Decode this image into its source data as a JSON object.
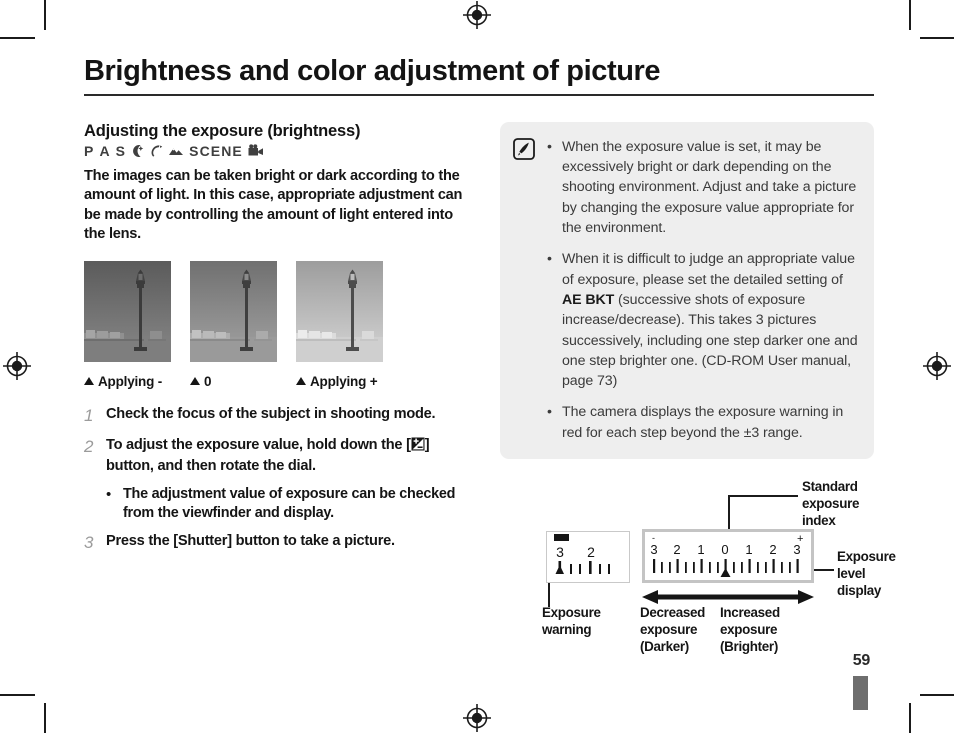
{
  "document": {
    "title": "Brightness and color adjustment of picture",
    "page_number": "59"
  },
  "left_column": {
    "section_heading": "Adjusting the exposure (brightness)",
    "mode_icons": [
      {
        "name": "mode-p",
        "label": "P"
      },
      {
        "name": "mode-a",
        "label": "A"
      },
      {
        "name": "mode-s",
        "label": "S"
      },
      {
        "name": "night-mode-icon",
        "label": ""
      },
      {
        "name": "wave-mode-icon",
        "label": ""
      },
      {
        "name": "landscape-mode-icon",
        "label": ""
      },
      {
        "name": "mode-scene",
        "label": "SCENE"
      },
      {
        "name": "movie-mode-icon",
        "label": ""
      }
    ],
    "intro_text": "The images can be taken bright or dark according to the amount of light. In this case, appropriate adjustment can be made by controlling the amount of light entered into the lens.",
    "photos": [
      {
        "caption": "Applying -",
        "alt": "Lamppost by river, darker exposure"
      },
      {
        "caption": "0",
        "alt": "Lamppost by river, standard exposure"
      },
      {
        "caption": "Applying +",
        "alt": "Lamppost by river, brighter exposure"
      }
    ],
    "steps": [
      {
        "number": "1",
        "text_before": "Check the focus of the subject in shooting mode.",
        "text_after": "",
        "has_glyph": false
      },
      {
        "number": "2",
        "text_before": "To adjust the exposure value, hold down the [",
        "text_after": "] button, and then rotate the dial.",
        "has_glyph": true,
        "glyph_name": "exposure-compensation-icon",
        "sub_bullet": "The adjustment value of exposure can be checked from the viewfinder and display."
      },
      {
        "number": "3",
        "text_before": "Press the ",
        "bold_part": "[Shutter]",
        "text_after": " button to take a picture.",
        "has_glyph": false
      }
    ],
    "bullet_char": "•"
  },
  "note_box": {
    "icon_name": "note-pencil-icon",
    "bullet_char": "•",
    "items": [
      {
        "before": "When the exposure value is set, it may be excessively bright or dark depending on the shooting environment. Adjust and take a picture by changing the exposure value appropriate for the environment.",
        "bold": "",
        "after": ""
      },
      {
        "before": "When it is difficult to judge an appropriate value of exposure, please set the detailed setting of ",
        "bold": "AE BKT",
        "after": " (successive shots of exposure increase/decrease). This takes 3 pictures successively, including one step darker one and one step brighter one. (CD-ROM User manual, page 73)"
      },
      {
        "before": "The camera displays the exposure warning in red for each step beyond the ±3 range.",
        "bold": "",
        "after": ""
      }
    ]
  },
  "diagram": {
    "labels": {
      "standard_exposure_index": "Standard\nexposure\nindex",
      "exposure_level_display": "Exposure\nlevel\ndisplay",
      "exposure_warning": "Exposure\nwarning",
      "decreased_exposure": "Decreased\nexposure\n(Darker)",
      "increased_exposure": "Increased\nexposure\n(Brighter)"
    },
    "warning_display": {
      "numbers": [
        "3",
        "2"
      ],
      "indicator": "filled-triangle-at-3"
    },
    "exposure_scale": {
      "minus_sign": "-",
      "plus_sign": "+",
      "numbers": [
        "3",
        "2",
        "1",
        "0",
        "1",
        "2",
        "3"
      ],
      "pointer_position": "0",
      "major_tick_count": 7,
      "minor_ticks_between": 2
    },
    "colors": {
      "scale_frame": "#c4c4c4",
      "note_background": "#eeeeee",
      "page_tab": "#6e6e6e",
      "ink": "#151515"
    }
  }
}
